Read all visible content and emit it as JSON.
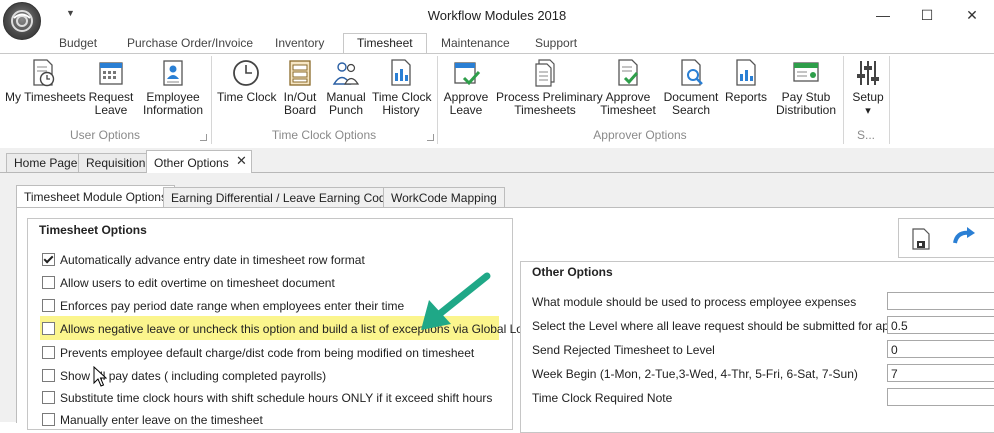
{
  "window": {
    "title": "Workflow Modules 2018",
    "minimize_glyph": "—",
    "maximize_glyph": "☐",
    "close_glyph": "✕",
    "quick_access_glyph": "▼"
  },
  "ribbon_tabs": [
    "Budget",
    "Purchase Order/Invoice",
    "Inventory",
    "Timesheet",
    "Maintenance",
    "Support"
  ],
  "ribbon_active_tab": "Timesheet",
  "ribbon": {
    "user_options": {
      "label": "User Options",
      "buttons": [
        {
          "label": "My Timesheets",
          "icon": "timesheet-clock-icon"
        },
        {
          "label": "Request\nLeave",
          "icon": "calendar-icon"
        },
        {
          "label": "Employee\nInformation",
          "icon": "employee-info-icon"
        }
      ]
    },
    "time_clock_options": {
      "label": "Time Clock Options",
      "buttons": [
        {
          "label": "Time Clock",
          "icon": "clock-icon"
        },
        {
          "label": "In/Out\nBoard",
          "icon": "board-icon"
        },
        {
          "label": "Manual\nPunch",
          "icon": "people-icon"
        },
        {
          "label": "Time Clock\nHistory",
          "icon": "history-icon"
        }
      ]
    },
    "approver_options": {
      "label": "Approver Options",
      "buttons": [
        {
          "label": "Approve\nLeave",
          "icon": "calendar-check-icon"
        },
        {
          "label": "Process Preliminary\nTimesheets",
          "icon": "documents-icon"
        },
        {
          "label": "Approve\nTimesheet",
          "icon": "document-check-icon"
        },
        {
          "label": "Document\nSearch",
          "icon": "document-search-icon"
        },
        {
          "label": "Reports",
          "icon": "reports-icon"
        },
        {
          "label": "Pay Stub\nDistribution",
          "icon": "paystub-icon"
        }
      ]
    },
    "setup": {
      "label": "S...",
      "button": {
        "label": "Setup",
        "icon": "sliders-icon",
        "dropdown_glyph": "▾"
      }
    }
  },
  "doc_tabs": [
    "Home Page",
    "Requisition",
    "Other Options"
  ],
  "doc_active_tab": "Other Options",
  "doc_tab_close_glyph": "✕",
  "inner_tabs": [
    "Timesheet Module Options",
    "Earning Differential / Leave Earning Codes",
    "WorkCode Mapping"
  ],
  "inner_active_tab": "Timesheet Module Options",
  "timesheet_options": {
    "title": "Timesheet Options",
    "items": [
      {
        "label": "Automatically advance entry date in timesheet row format",
        "checked": true
      },
      {
        "label": "Allow users to edit overtime on timesheet document",
        "checked": false
      },
      {
        "label": "Enforces pay period date range when employees enter their time",
        "checked": false
      },
      {
        "label": "Allows negative leave or uncheck this option and build a list of exceptions via Global Lookup",
        "checked": false
      },
      {
        "label": "Prevents employee default charge/dist code from being modified on timesheet",
        "checked": false
      },
      {
        "label": "Show all pay dates ( including completed payrolls)",
        "checked": false
      },
      {
        "label": "Substitute time clock hours with shift schedule hours ONLY if it exceed shift hours",
        "checked": false
      },
      {
        "label": "Manually enter leave on the timesheet",
        "checked": false
      }
    ]
  },
  "other_options": {
    "title": "Other Options",
    "rows": [
      {
        "label": "What module should be used to process employee expenses",
        "value": ""
      },
      {
        "label": "Select the Level where all leave request should be submitted for approval",
        "value": "0.5"
      },
      {
        "label": "Send Rejected Timesheet to Level",
        "value": "0"
      },
      {
        "label": "Week Begin (1-Mon, 2-Tue,3-Wed, 4-Thr, 5-Fri, 6-Sat, 7-Sun)",
        "value": "7"
      },
      {
        "label": "Time Clock Required Note",
        "value": ""
      }
    ]
  },
  "colors": {
    "highlight": "#fbf58d",
    "arrow": "#1fa887",
    "accent_blue": "#2a7fd4",
    "icon_green": "#2e9e4a"
  }
}
